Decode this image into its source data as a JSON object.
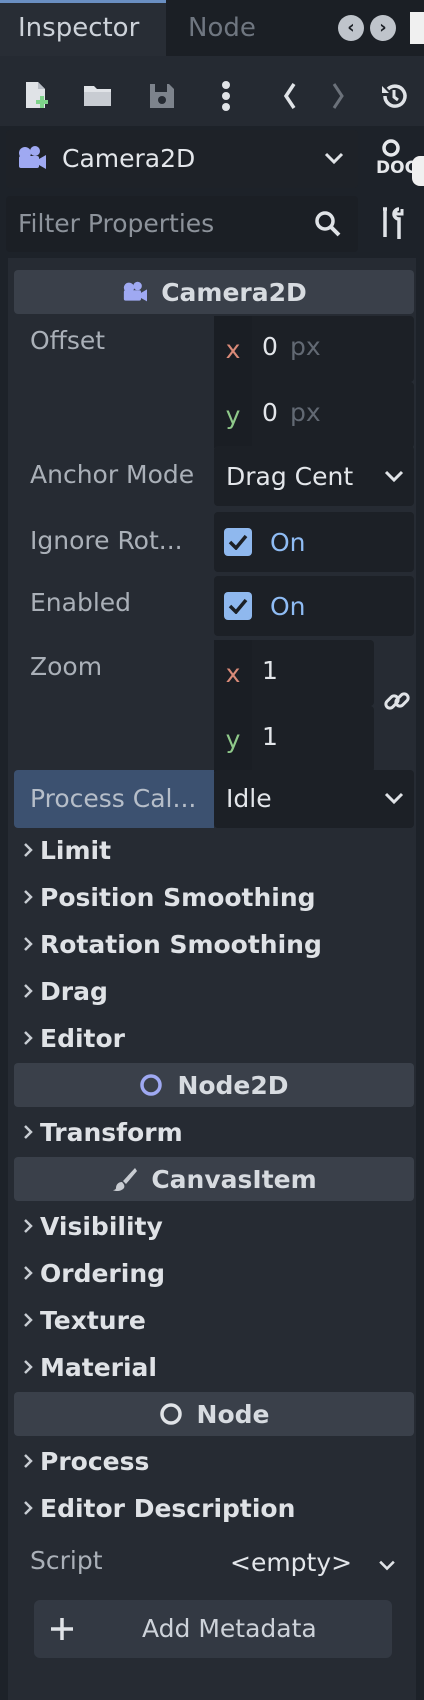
{
  "tabs": {
    "inspector": "Inspector",
    "node": "Node"
  },
  "node_selector": {
    "name": "Camera2D",
    "doc_label": "DOC"
  },
  "filter": {
    "placeholder": "Filter Properties"
  },
  "camera_section": {
    "title": "Camera2D",
    "offset": {
      "label": "Offset",
      "x_axis": "x",
      "x_value": "0",
      "y_axis": "y",
      "y_value": "0",
      "unit": "px"
    },
    "anchor_mode": {
      "label": "Anchor Mode",
      "value": "Drag Cent"
    },
    "ignore_rotation": {
      "label": "Ignore Rot...",
      "value": "On",
      "checked": true
    },
    "enabled": {
      "label": "Enabled",
      "value": "On",
      "checked": true
    },
    "zoom": {
      "label": "Zoom",
      "x_axis": "x",
      "x_value": "1",
      "y_axis": "y",
      "y_value": "1"
    },
    "process_callback": {
      "label": "Process Cal...",
      "value": "Idle"
    },
    "groups": [
      "Limit",
      "Position Smoothing",
      "Rotation Smoothing",
      "Drag",
      "Editor"
    ]
  },
  "node2d_section": {
    "title": "Node2D",
    "groups": [
      "Transform"
    ]
  },
  "canvasitem_section": {
    "title": "CanvasItem",
    "groups": [
      "Visibility",
      "Ordering",
      "Texture",
      "Material"
    ]
  },
  "node_section": {
    "title": "Node",
    "groups": [
      "Process",
      "Editor Description"
    ]
  },
  "script": {
    "label": "Script",
    "value": "<empty>"
  },
  "metadata": {
    "add_label": "Add Metadata"
  },
  "colors": {
    "accent": "#8fbcf4",
    "x_axis": "#d98a78",
    "y_axis": "#8fc98a",
    "camera_icon": "#9fa9f2"
  }
}
